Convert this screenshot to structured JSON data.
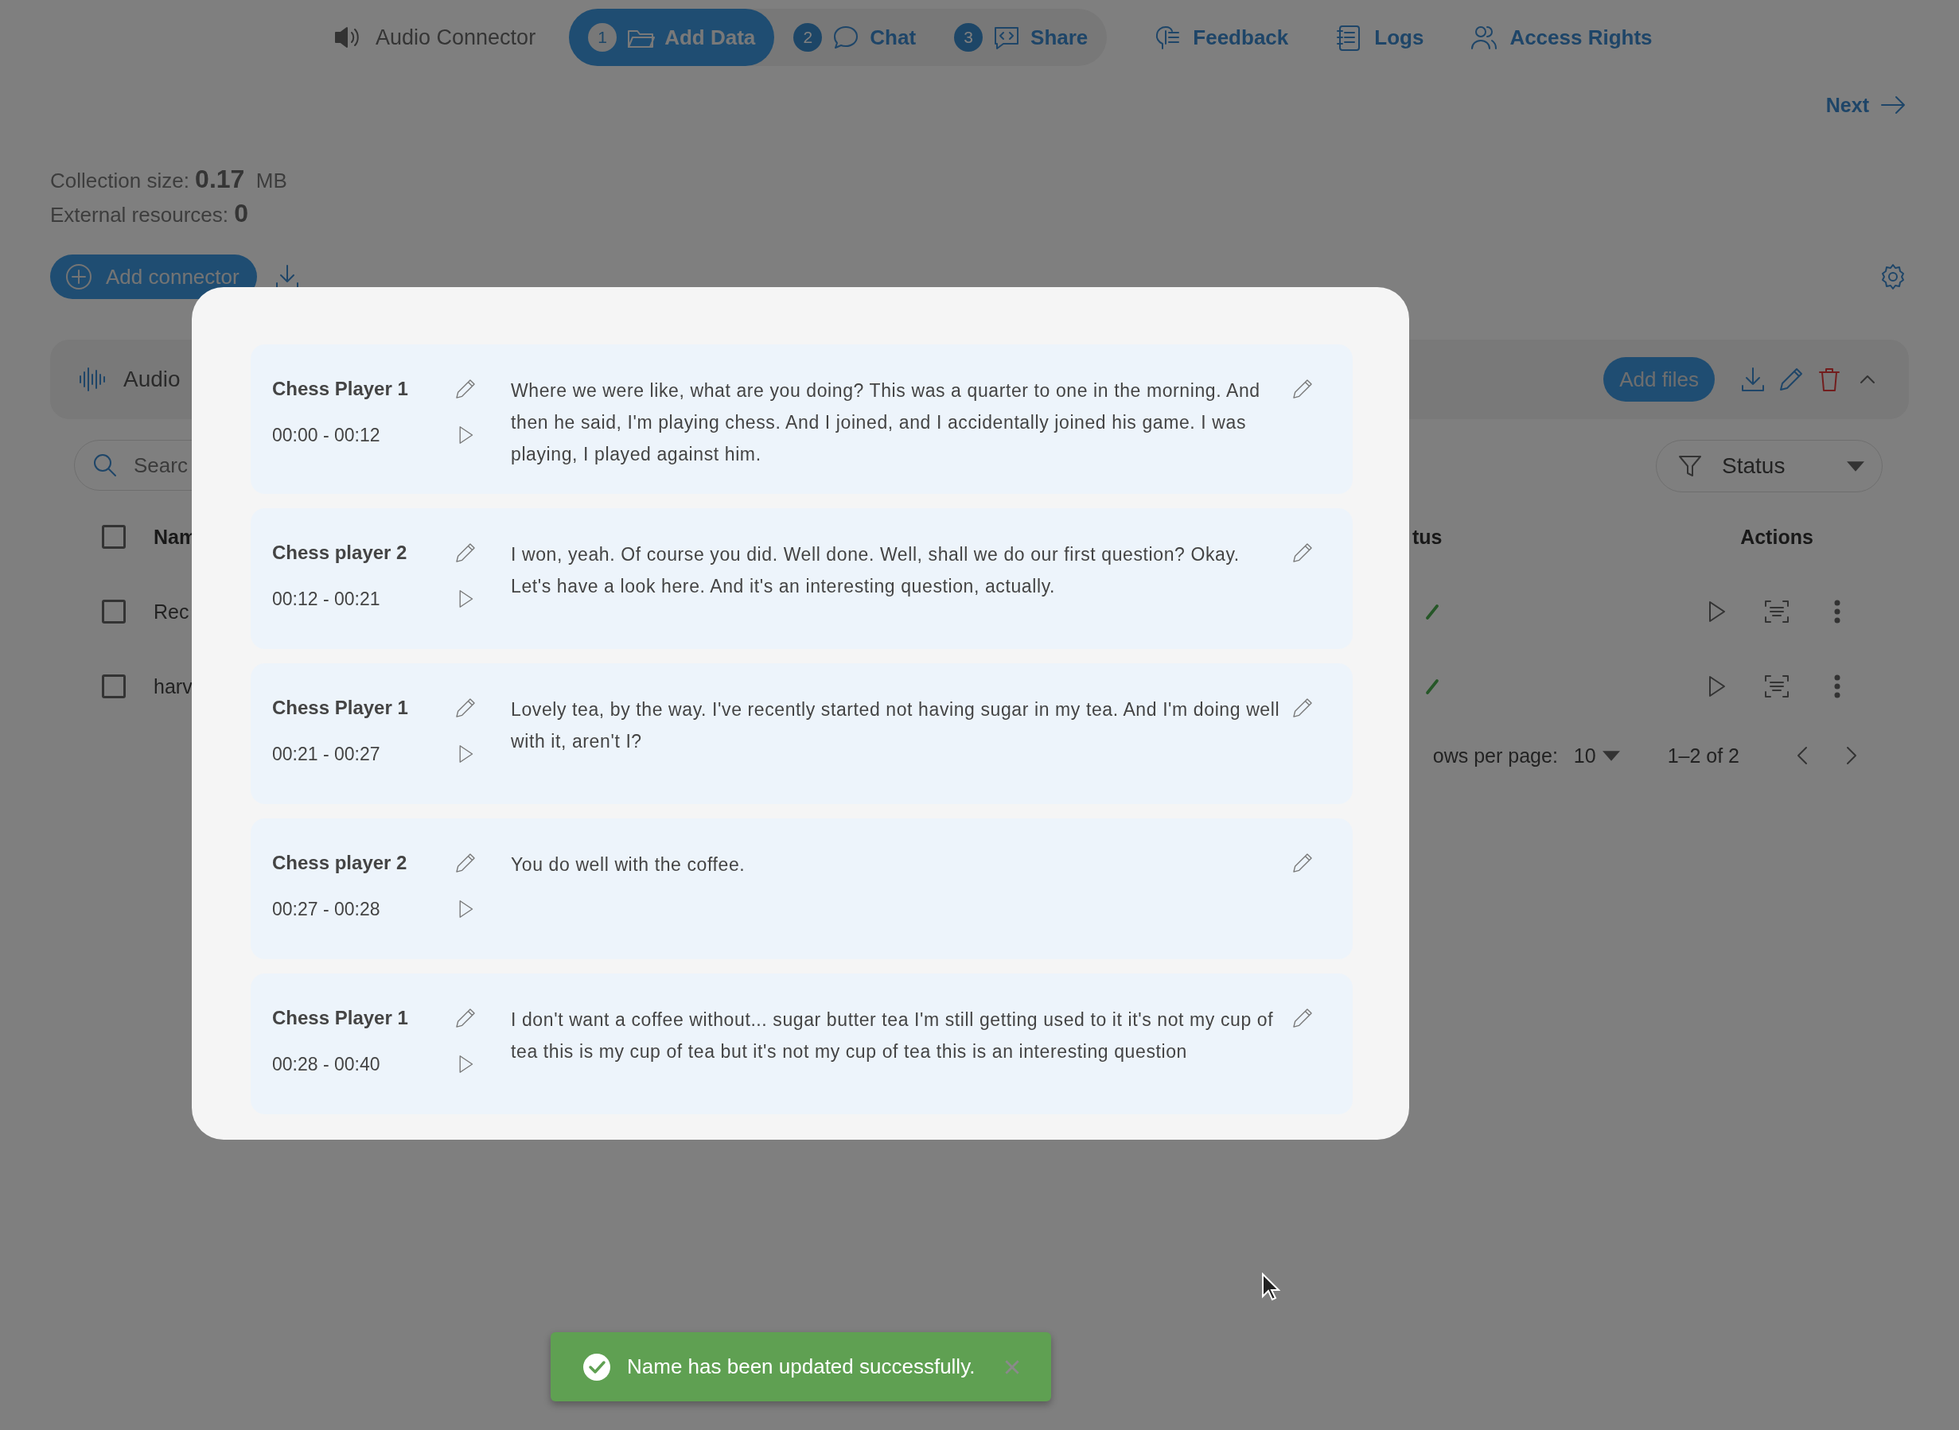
{
  "app": {
    "title": "Audio Connector"
  },
  "steps": [
    {
      "number": "1",
      "label": "Add Data",
      "kind": "folder",
      "selected": true
    },
    {
      "number": "2",
      "label": "Chat",
      "kind": "chat",
      "selected": false
    },
    {
      "number": "3",
      "label": "Share",
      "kind": "code",
      "selected": false
    }
  ],
  "nav_links": [
    {
      "label": "Feedback",
      "kind": "feedback"
    },
    {
      "label": "Logs",
      "kind": "logs"
    },
    {
      "label": "Access Rights",
      "kind": "people"
    }
  ],
  "next_button": "Next",
  "stats": [
    {
      "label": "Collection size:",
      "value": "0.17",
      "unit": "MB"
    },
    {
      "label": "External resources:",
      "value": "0"
    }
  ],
  "add_connector_button": "Add connector",
  "connector": {
    "name": "Audio",
    "add_files_button": "Add files",
    "expanded": true
  },
  "search": {
    "placeholder": "Searc"
  },
  "filter": {
    "label": "Status"
  },
  "table": {
    "select_all_checked": false,
    "columns": [
      {
        "label": "Nam",
        "kind": "name"
      },
      {
        "label": "tus",
        "kind": "status"
      },
      {
        "label": "Actions",
        "kind": "actions"
      }
    ],
    "rows": [
      {
        "name": "Rec",
        "checked": false,
        "done": true
      },
      {
        "name": "harv",
        "checked": false,
        "done": true
      }
    ]
  },
  "pagination": {
    "rows_label": "ows per page:",
    "rows_per_page": "10",
    "range": "1–2 of 2"
  },
  "transcript": [
    {
      "speaker": "Chess Player 1",
      "time": "00:00 - 00:12",
      "text": "Where we were like, what are you doing? This was a quarter to one in the morning. And then he said, I'm playing chess. And I joined, and I accidentally joined his game. I was playing, I played against him."
    },
    {
      "speaker": "Chess player 2",
      "time": "00:12 - 00:21",
      "text": "I won, yeah. Of course you did. Well done. Well, shall we do our first question? Okay. Let's have a look here. And it's an interesting question, actually."
    },
    {
      "speaker": "Chess Player 1",
      "time": "00:21 - 00:27",
      "text": "Lovely tea, by the way. I've recently started not having sugar in my tea. And I'm doing well with it, aren't I?"
    },
    {
      "speaker": "Chess player 2",
      "time": "00:27 - 00:28",
      "text": "You do well with the coffee."
    },
    {
      "speaker": "Chess Player 1",
      "time": "00:28 - 00:40",
      "text": "I don't want a coffee without... sugar butter tea I'm still getting used to it it's not my cup of tea this is my cup of tea but it's not my cup of tea this is an interesting question"
    }
  ],
  "toast": {
    "message": "Name has been updated successfully.",
    "kind": "success"
  }
}
